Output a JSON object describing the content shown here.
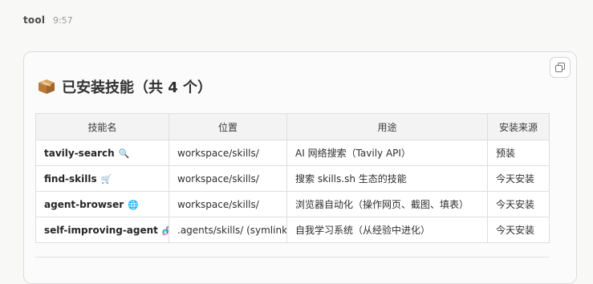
{
  "message": {
    "sender": "tool",
    "time": "9:57"
  },
  "card": {
    "title": "已安装技能（共 4 个）",
    "title_icon": "package-icon",
    "copy_icon": "copy-icon"
  },
  "table": {
    "headers": [
      "技能名",
      "位置",
      "用途",
      "安装来源"
    ],
    "rows": [
      {
        "name": "tavily-search",
        "emoji": "🔍",
        "icon": "magnifier-icon",
        "location": "workspace/skills/",
        "purpose": "AI 网络搜索（Tavily API）",
        "source": "预装"
      },
      {
        "name": "find-skills",
        "emoji": "🛒",
        "icon": "shopping-cart-icon",
        "location": "workspace/skills/",
        "purpose": "搜索 skills.sh 生态的技能",
        "source": "今天安装"
      },
      {
        "name": "agent-browser",
        "emoji": "🌐",
        "icon": "globe-icon",
        "location": "workspace/skills/",
        "purpose": "浏览器自动化（操作网页、截图、填表）",
        "source": "今天安装"
      },
      {
        "name": "self-improving-agent",
        "emoji": "🧬",
        "icon": "dna-icon",
        "location": ".agents/skills/ (symlink)",
        "purpose": "自我学习系统（从经验中进化）",
        "source": "今天安装"
      }
    ]
  },
  "colors": {
    "page_bg": "#f8f8f7",
    "card_bg": "#fbfbfb",
    "border": "#dedede",
    "header_bg": "#f3f3f3"
  }
}
